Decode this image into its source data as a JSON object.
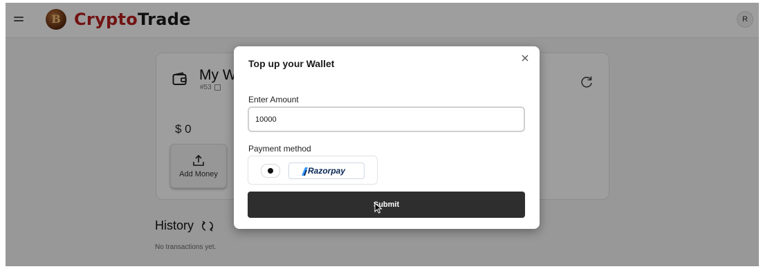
{
  "header": {
    "brand_part1": "Crypto",
    "brand_part2": "Trade",
    "logo_letter": "B",
    "avatar_initial": "R"
  },
  "wallet": {
    "title": "My Wallet",
    "id": "#53",
    "balance": "$ 0",
    "add_money_label": "Add Money"
  },
  "history": {
    "title": "History",
    "empty_text": "No transactions yet."
  },
  "modal": {
    "title": "Top up your Wallet",
    "amount_label": "Enter Amount",
    "amount_value": "10000",
    "payment_label": "Payment method",
    "payment_option": "Razorpay",
    "submit_label": "Submit"
  },
  "colors": {
    "brand_red": "#b81f1f",
    "submit_bg": "#2e2e2e",
    "razorpay_navy": "#072654",
    "razorpay_blue": "#3395ff"
  },
  "icons": [
    "menu-icon",
    "logo-icon",
    "wallet-icon",
    "copy-icon",
    "refresh-icon",
    "upload-icon",
    "history-refresh-icon",
    "close-icon",
    "razorpay-mark-icon",
    "cursor-icon"
  ]
}
